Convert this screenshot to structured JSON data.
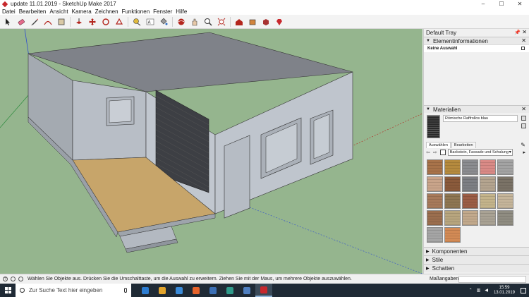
{
  "window": {
    "title": "update 11.01.2019 - SketchUp Make 2017",
    "controls": [
      "–",
      "☐",
      "✕"
    ]
  },
  "menu": [
    "Datei",
    "Bearbeiten",
    "Ansicht",
    "Kamera",
    "Zeichnen",
    "Funktionen",
    "Fenster",
    "Hilfe"
  ],
  "toolbar_icons": [
    "select-arrow-icon",
    "eraser-icon",
    "pencil-icon",
    "arc-icon",
    "rectangle-icon",
    "push-pull-icon",
    "move-icon",
    "rotate-icon",
    "offset-icon",
    "tape-measure-icon",
    "text-icon",
    "paint-bucket-icon",
    "orbit-icon",
    "pan-icon",
    "zoom-icon",
    "zoom-extents-icon",
    "warehouse-icon",
    "extension-warehouse-icon",
    "components-icon",
    "ruby-icon"
  ],
  "tray": {
    "title": "Default Tray",
    "entity_info": {
      "title": "Elementinformationen",
      "selection": "Keine Auswahl"
    },
    "materials": {
      "title": "Materialien",
      "current_name": "Römische Raffrollos blau",
      "tabs": [
        "Auswählen",
        "Bearbeiten"
      ],
      "library": "Backstein, Fassade und Schalung",
      "swatch_colors": [
        "#a8734a",
        "#b58a3e",
        "#8b8c90",
        "#d98a86",
        "#a3a3a3",
        "#c9a48a",
        "#8a5a3b",
        "#7d7f84",
        "#b4a48f",
        "#7a7266",
        "#a77a5b",
        "#8e7652",
        "#9b5d45",
        "#c4b48b",
        "#c5b59a",
        "#9b6e4e",
        "#b7a57e",
        "#c2a98c",
        "#a9a294",
        "#8f8c81",
        "#a5a5a5",
        "#d28a55"
      ]
    },
    "collapsed_panels": [
      "Komponenten",
      "Stile",
      "Schatten"
    ]
  },
  "statusbar": {
    "hint": "Wählen Sie Objekte aus. Drücken Sie die Umschalttaste, um die Auswahl zu erweitern. Ziehen Sie mit der Maus, um mehrere Objekte auszuwählen.",
    "measure_label": "Maßangaben",
    "measure_value": ""
  },
  "taskbar": {
    "search_placeholder": "Zur Suche Text hier eingeben",
    "clock_time": "15:59",
    "clock_date": "13.01.2019",
    "app_icon_colors": [
      "#2d7dd2",
      "#e2a42b",
      "#3a8bd9",
      "#e6632b",
      "#3b6fb5",
      "#2e9a8a",
      "#4f7fc0",
      "#c8282d"
    ]
  }
}
